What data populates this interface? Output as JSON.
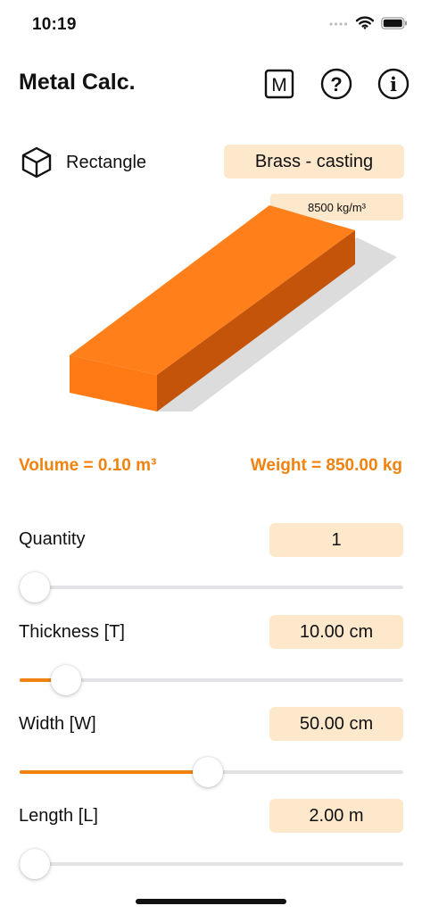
{
  "status_bar": {
    "time": "10:19"
  },
  "header": {
    "title": "Metal Calc.",
    "buttons": [
      {
        "label": "M",
        "icon": "material-m-icon"
      },
      {
        "label": "?",
        "icon": "help-icon"
      },
      {
        "label": "i",
        "icon": "info-icon"
      }
    ]
  },
  "shape": {
    "icon": "cube-icon",
    "label": "Rectangle"
  },
  "material": {
    "label": "Brass - casting",
    "density": "8500 kg/m³"
  },
  "colors": {
    "accent": "#f0820f",
    "block_top": "#ff7f1a",
    "block_front": "#ff7a14",
    "block_side": "#c4540a",
    "value_bg": "#fde8cc"
  },
  "results": {
    "volume": "Volume = 0.10 m³",
    "weight": "Weight = 850.00 kg"
  },
  "params": [
    {
      "label": "Quantity",
      "value": "1",
      "level": 0.04
    },
    {
      "label": "Thickness [T]",
      "value": "10.00 cm",
      "level": 0.12
    },
    {
      "label": "Width [W]",
      "value": "50.00 cm",
      "level": 0.49
    },
    {
      "label": "Length [L]",
      "value": "2.00 m",
      "level": 0.04
    }
  ]
}
